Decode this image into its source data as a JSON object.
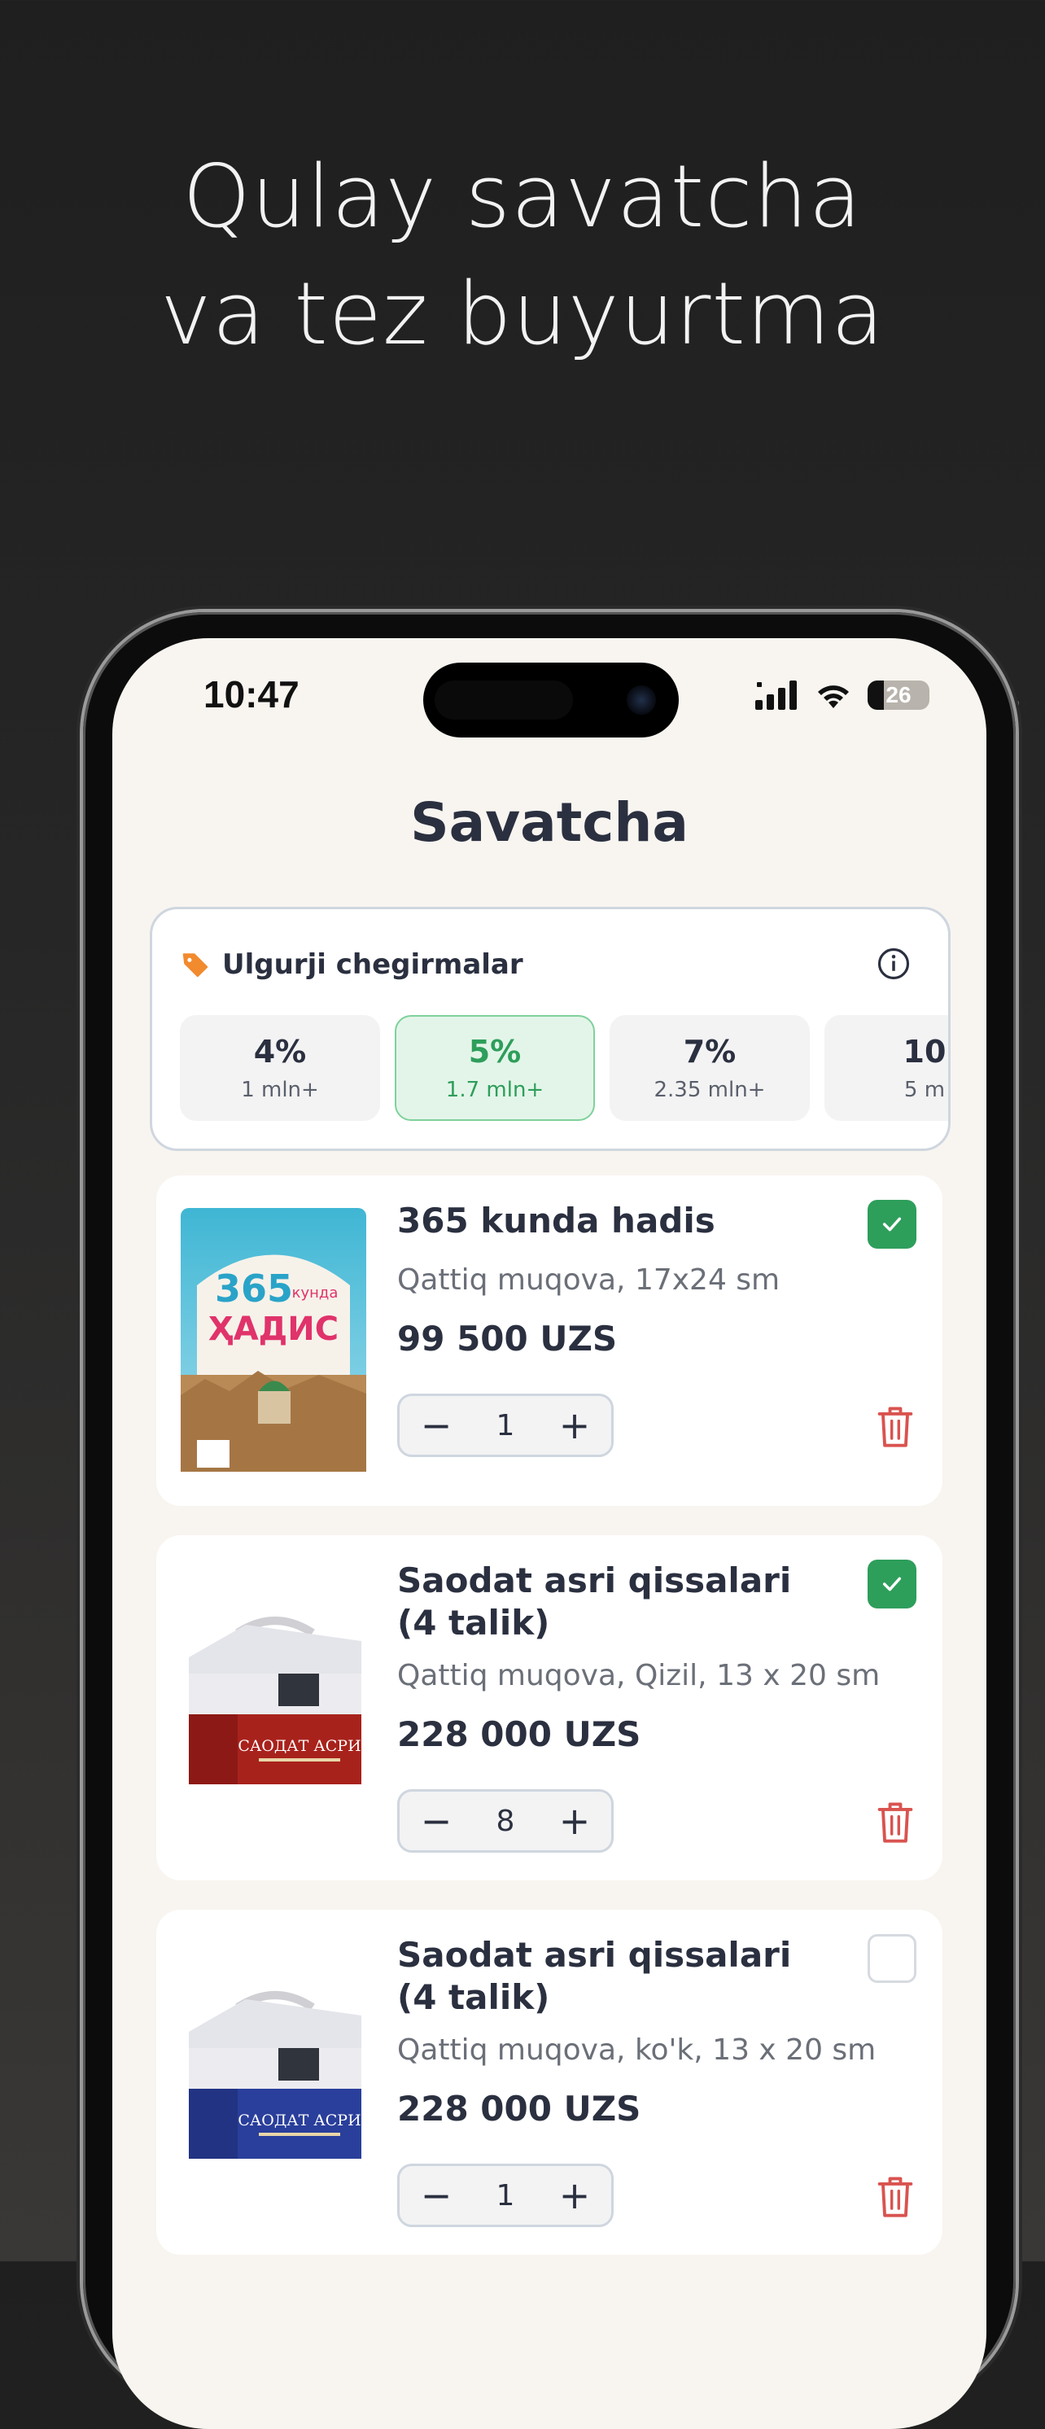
{
  "headline": {
    "line1": "Qulay savatcha",
    "line2": "va tez buyurtma"
  },
  "status_bar": {
    "time": "10:47",
    "battery": "26"
  },
  "page": {
    "title": "Savatcha"
  },
  "discounts": {
    "title": "Ulgurji chegirmalar",
    "tiers": [
      {
        "percent": "4%",
        "threshold": "1 mln+"
      },
      {
        "percent": "5%",
        "threshold": "1.7 mln+"
      },
      {
        "percent": "7%",
        "threshold": "2.35 mln+"
      },
      {
        "percent": "10",
        "threshold": "5 m"
      }
    ],
    "active_index": 1
  },
  "cart": {
    "items": [
      {
        "name": "365 kunda hadis",
        "meta": "Qattiq muqova, 17x24 sm",
        "price": "99 500 UZS",
        "quantity": "1",
        "checked": true,
        "cover_top": "365",
        "cover_small": "кунда",
        "cover_main": "ҲАДИС"
      },
      {
        "name": "Saodat asri qissalari (4 talik)",
        "meta": "Qattiq muqova, Qizil, 13 x 20 sm",
        "price": "228 000 UZS",
        "quantity": "8",
        "checked": true,
        "cover_main": "САОДАТ АСРИ"
      },
      {
        "name": "Saodat asri qissalari (4 talik)",
        "meta": "Qattiq muqova, ko'k, 13 x 20 sm",
        "price": "228 000 UZS",
        "quantity": "1",
        "checked": false,
        "cover_main": "САОДАТ АСРИ"
      }
    ]
  },
  "colors": {
    "accent_green": "#2e9e5b",
    "tag_orange": "#f28a2e",
    "delete_red": "#d9534f",
    "text_dark": "#2b3040"
  }
}
